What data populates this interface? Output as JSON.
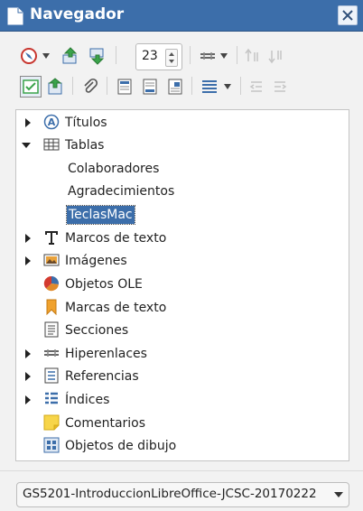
{
  "window": {
    "title": "Navegador"
  },
  "toolbar1": {
    "page_value": "23"
  },
  "tree": {
    "items": [
      {
        "label": "Títulos",
        "icon": "headings-icon",
        "expander": "collapsed"
      },
      {
        "label": "Tablas",
        "icon": "table-icon",
        "expander": "expanded"
      },
      {
        "label": "Colaboradores"
      },
      {
        "label": "Agradecimientos"
      },
      {
        "label": "TeclasMac",
        "selected": true
      },
      {
        "label": "Marcos de texto",
        "icon": "text-frame-icon",
        "expander": "collapsed"
      },
      {
        "label": "Imágenes",
        "icon": "image-icon",
        "expander": "collapsed"
      },
      {
        "label": "Objetos OLE",
        "icon": "ole-object-icon"
      },
      {
        "label": "Marcas de texto",
        "icon": "bookmark-icon"
      },
      {
        "label": "Secciones",
        "icon": "section-icon"
      },
      {
        "label": "Hiperenlaces",
        "icon": "hyperlink-icon",
        "expander": "collapsed"
      },
      {
        "label": "Referencias",
        "icon": "reference-icon",
        "expander": "collapsed"
      },
      {
        "label": "Índices",
        "icon": "index-icon",
        "expander": "collapsed"
      },
      {
        "label": "Comentarios",
        "icon": "comment-icon"
      },
      {
        "label": "Objetos de dibujo",
        "icon": "drawing-object-icon"
      }
    ]
  },
  "document_selector": {
    "value": "GS5201-IntroduccionLibreOffice-JCSC-20170222"
  },
  "colors": {
    "titlebar": "#3c6eaa",
    "selection": "#3c6eaa",
    "accent_green": "#3aa34a"
  }
}
